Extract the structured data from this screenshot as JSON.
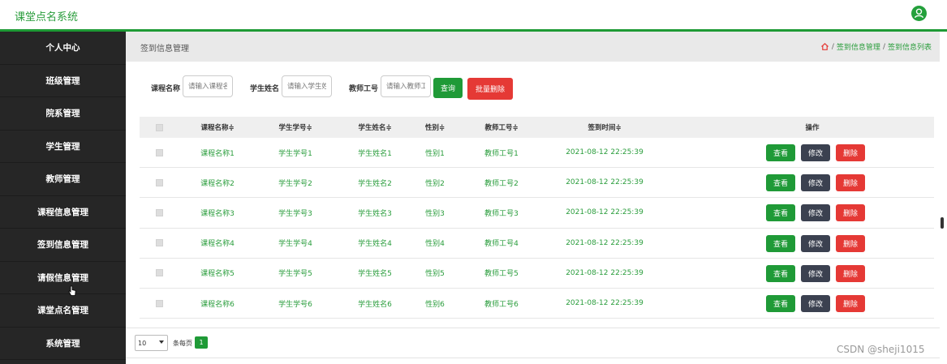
{
  "app": {
    "title": "课堂点名系统"
  },
  "sidebar": {
    "items": [
      {
        "label": "个人中心"
      },
      {
        "label": "班级管理"
      },
      {
        "label": "院系管理"
      },
      {
        "label": "学生管理"
      },
      {
        "label": "教师管理"
      },
      {
        "label": "课程信息管理"
      },
      {
        "label": "签到信息管理"
      },
      {
        "label": "请假信息管理"
      },
      {
        "label": "课堂点名管理"
      },
      {
        "label": "系统管理"
      }
    ]
  },
  "page": {
    "title": "签到信息管理",
    "breadcrumb": [
      "签到信息管理",
      "签到信息列表"
    ]
  },
  "search": {
    "course_label": "课程名称",
    "course_placeholder": "请输入课程名称",
    "student_label": "学生姓名",
    "student_placeholder": "请输入学生姓名",
    "teacher_label": "教师工号",
    "teacher_placeholder": "请输入教师工号",
    "query_button": "查询",
    "batch_delete_button": "批量删除"
  },
  "table": {
    "headers": [
      "课程名称≑",
      "学生学号≑",
      "学生姓名≑",
      "性别≑",
      "教师工号≑",
      "签到时间≑",
      "操作"
    ],
    "rows": [
      [
        "课程名称1",
        "学生学号1",
        "学生姓名1",
        "性别1",
        "教师工号1",
        "2021-08-12 22:25:39"
      ],
      [
        "课程名称2",
        "学生学号2",
        "学生姓名2",
        "性别2",
        "教师工号2",
        "2021-08-12 22:25:39"
      ],
      [
        "课程名称3",
        "学生学号3",
        "学生姓名3",
        "性别3",
        "教师工号3",
        "2021-08-12 22:25:39"
      ],
      [
        "课程名称4",
        "学生学号4",
        "学生姓名4",
        "性别4",
        "教师工号4",
        "2021-08-12 22:25:39"
      ],
      [
        "课程名称5",
        "学生学号5",
        "学生姓名5",
        "性别5",
        "教师工号5",
        "2021-08-12 22:25:39"
      ],
      [
        "课程名称6",
        "学生学号6",
        "学生姓名6",
        "性别6",
        "教师工号6",
        "2021-08-12 22:25:39"
      ]
    ],
    "actions": {
      "view": "查看",
      "edit": "修改",
      "delete": "删除"
    }
  },
  "pager": {
    "page_size": "10",
    "per_page_label": "条每页",
    "current_page": "1"
  },
  "watermark": "CSDN @sheji1015",
  "colors": {
    "accent": "#1f9a37",
    "danger": "#e53935",
    "sidebar": "#262626"
  }
}
